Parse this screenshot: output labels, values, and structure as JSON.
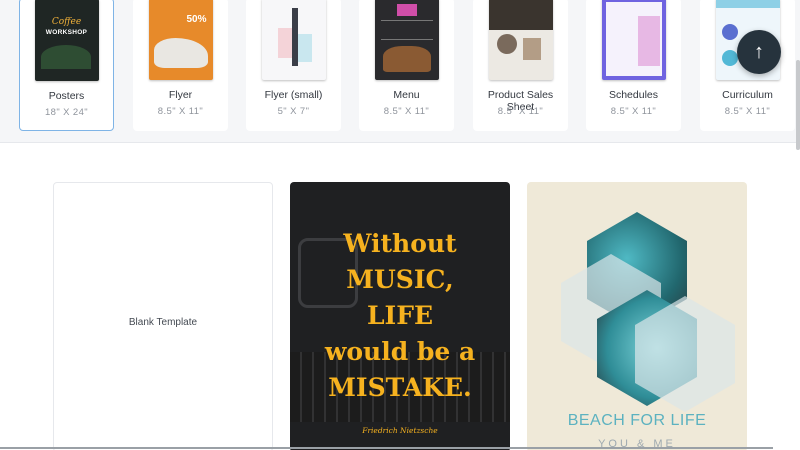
{
  "categories": [
    {
      "name": "Posters",
      "size": "18\" X 24\"",
      "thumb": "Coffee WORKSHOP"
    },
    {
      "name": "Flyer",
      "size": "8.5\" X 11\"",
      "thumb": "50%"
    },
    {
      "name": "Flyer (small)",
      "size": "5\" X 7\""
    },
    {
      "name": "Menu",
      "size": "8.5\" X 11\""
    },
    {
      "name": "Product Sales Sheet",
      "size": "8.5\" X 11\""
    },
    {
      "name": "Schedules",
      "size": "8.5\" X 11\""
    },
    {
      "name": "Curriculum",
      "size": "8.5\" X 11\""
    }
  ],
  "scroll_top_icon": "arrow-up-icon",
  "templates": {
    "blank": {
      "label": "Blank Template"
    },
    "music": {
      "lines": [
        "Without",
        "MUSIC,",
        "LIFE",
        "would be a",
        "MISTAKE."
      ],
      "author": "Friedrich Nietzsche",
      "color": "#f6b21f"
    },
    "beach": {
      "title": "BEACH FOR LIFE",
      "subtitle": "YOU & ME"
    }
  },
  "colors": {
    "accent": "#7fb4e6",
    "dark_button": "#26333d"
  }
}
